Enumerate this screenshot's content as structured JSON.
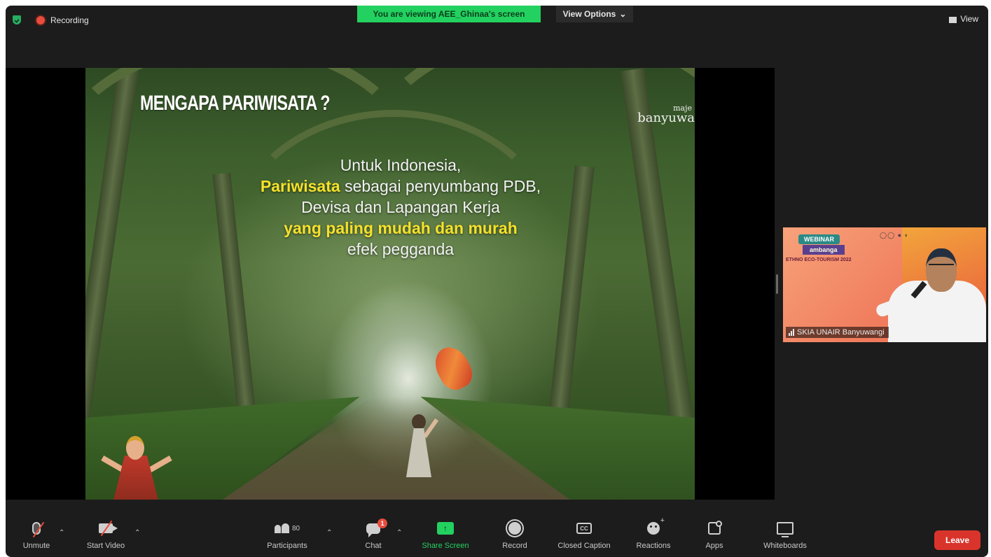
{
  "topbar": {
    "recording_label": "Recording",
    "viewing_banner": "You are viewing AEE_Ghinaa's screen",
    "view_options_label": "View Options",
    "view_label": "View",
    "shield_color": "#27ae60",
    "banner_color": "#23d160"
  },
  "slide": {
    "title": "MENGAPA PARIWISATA ?",
    "brand_line1": "maje",
    "brand_line2": "banyuwa",
    "line1": "Untuk Indonesia,",
    "line2_highlight": "Pariwisata",
    "line2_rest": " sebagai penyumbang PDB,",
    "line3": "Devisa dan Lapangan Kerja",
    "line4_highlight": "yang paling mudah dan murah",
    "line5": "efek pegganda",
    "highlight_color": "#f5e12a"
  },
  "video_tile": {
    "webinar_tag": "WEBINAR",
    "ribbon_text": "ambanga",
    "event_text": "ETHNO ECO-TOURISM 2022",
    "participant_name": "SKIA UNAIR Banyuwangi"
  },
  "toolbar": {
    "unmute": "Unmute",
    "start_video": "Start Video",
    "participants": "Participants",
    "participants_count": "80",
    "chat": "Chat",
    "chat_badge": "1",
    "share_screen": "Share Screen",
    "record": "Record",
    "closed_caption": "Closed Caption",
    "cc_glyph": "CC",
    "reactions": "Reactions",
    "apps": "Apps",
    "whiteboards": "Whiteboards",
    "leave": "Leave",
    "leave_color": "#d9342b"
  }
}
